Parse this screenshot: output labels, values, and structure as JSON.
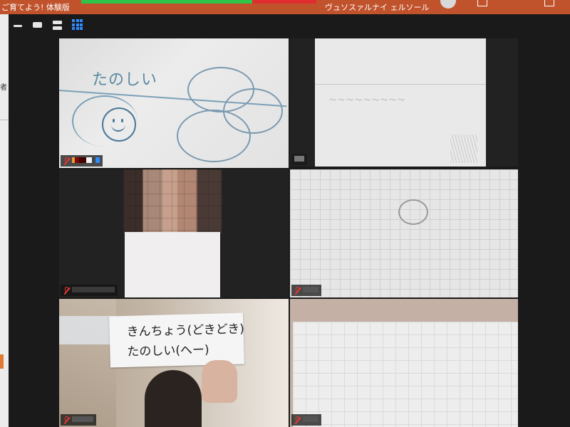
{
  "background": {
    "window_title_left": "ご育てよう! 体験版",
    "window_title_right": "ヴュソスァルナイ ェルソール"
  },
  "toolbar": {
    "icons": [
      "minimize-icon",
      "gallery-small-icon",
      "stack-view-icon",
      "grid-view-icon"
    ],
    "accent_color": "#2d8cff"
  },
  "participants": [
    {
      "tile": 1,
      "content": "drawing",
      "drawing_text": "たのしい",
      "muted": true,
      "active_speaker": true
    },
    {
      "tile": 2,
      "content": "paper",
      "muted": false
    },
    {
      "tile": 3,
      "content": "person",
      "muted": true
    },
    {
      "tile": 4,
      "content": "grid-paper",
      "muted": true
    },
    {
      "tile": 5,
      "content": "card",
      "card_line_1": "きんちょう(どきどき)",
      "card_line_2": "たのしい(へー)",
      "muted": true
    },
    {
      "tile": 6,
      "content": "grid-paper",
      "muted": true
    }
  ],
  "colors": {
    "active_speaker_border": "#c8f050",
    "muted_icon": "#e53935"
  }
}
